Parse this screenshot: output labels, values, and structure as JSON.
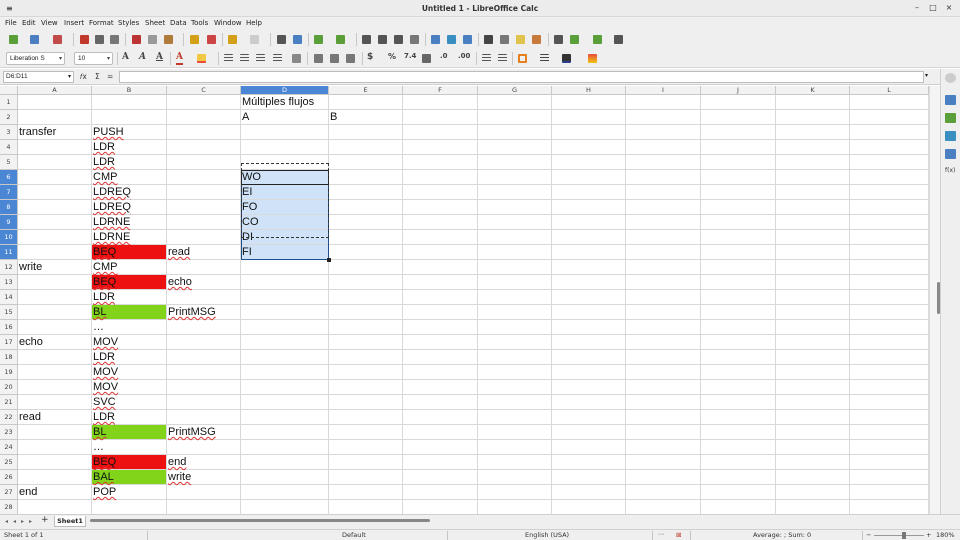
{
  "window": {
    "title": "Untitled 1 - LibreOffice Calc",
    "minimize": "–",
    "maximize": "□",
    "close": "×"
  },
  "menu": [
    "File",
    "Edit",
    "View",
    "Insert",
    "Format",
    "Styles",
    "Sheet",
    "Data",
    "Tools",
    "Window",
    "Help"
  ],
  "formatting": {
    "font_name": "Liberation S",
    "font_size": "10"
  },
  "formula_bar": {
    "name_box": "D6:D11",
    "value": ""
  },
  "columns": [
    "A",
    "B",
    "C",
    "D",
    "E",
    "F",
    "G",
    "H",
    "I",
    "J",
    "K",
    "L"
  ],
  "selected_column": "D",
  "selected_rows": [
    6,
    7,
    8,
    9,
    10,
    11
  ],
  "rows": [
    {
      "n": "1",
      "A": "",
      "B": "",
      "C": "",
      "D": "Múltiples flujos",
      "E": ""
    },
    {
      "n": "2",
      "A": "",
      "B": "",
      "C": "",
      "D": "A",
      "E": "B"
    },
    {
      "n": "3",
      "A": "transfer",
      "B": "PUSH",
      "C": "",
      "D": "",
      "E": ""
    },
    {
      "n": "4",
      "A": "",
      "B": "LDR",
      "C": "",
      "D": "",
      "E": ""
    },
    {
      "n": "5",
      "A": "",
      "B": "LDR",
      "C": "",
      "D": "",
      "E": ""
    },
    {
      "n": "6",
      "A": "",
      "B": "CMP",
      "C": "",
      "D": "WO",
      "E": ""
    },
    {
      "n": "7",
      "A": "",
      "B": "LDREQ",
      "C": "",
      "D": "EI",
      "E": ""
    },
    {
      "n": "8",
      "A": "",
      "B": "LDREQ",
      "C": "",
      "D": "FO",
      "E": ""
    },
    {
      "n": "9",
      "A": "",
      "B": "LDRNE",
      "C": "",
      "D": "CO",
      "E": ""
    },
    {
      "n": "10",
      "A": "",
      "B": "LDRNE",
      "C": "",
      "D": "DI",
      "E": ""
    },
    {
      "n": "11",
      "A": "",
      "B": "BEQ",
      "C": "read",
      "D": "FI",
      "E": ""
    },
    {
      "n": "12",
      "A": "write",
      "B": "CMP",
      "C": "",
      "D": "",
      "E": ""
    },
    {
      "n": "13",
      "A": "",
      "B": "BEQ",
      "C": "echo",
      "D": "",
      "E": ""
    },
    {
      "n": "14",
      "A": "",
      "B": "LDR",
      "C": "",
      "D": "",
      "E": ""
    },
    {
      "n": "15",
      "A": "",
      "B": "BL",
      "C": "PrintMSG",
      "D": "",
      "E": ""
    },
    {
      "n": "16",
      "A": "",
      "B": "…",
      "C": "",
      "D": "",
      "E": ""
    },
    {
      "n": "17",
      "A": "echo",
      "B": "MOV",
      "C": "",
      "D": "",
      "E": ""
    },
    {
      "n": "18",
      "A": "",
      "B": "LDR",
      "C": "",
      "D": "",
      "E": ""
    },
    {
      "n": "19",
      "A": "",
      "B": "MOV",
      "C": "",
      "D": "",
      "E": ""
    },
    {
      "n": "20",
      "A": "",
      "B": "MOV",
      "C": "",
      "D": "",
      "E": ""
    },
    {
      "n": "21",
      "A": "",
      "B": "SVC",
      "C": "",
      "D": "",
      "E": ""
    },
    {
      "n": "22",
      "A": "read",
      "B": "LDR",
      "C": "",
      "D": "",
      "E": ""
    },
    {
      "n": "23",
      "A": "",
      "B": "BL",
      "C": "PrintMSG",
      "D": "",
      "E": ""
    },
    {
      "n": "24",
      "A": "",
      "B": "…",
      "C": "",
      "D": "",
      "E": ""
    },
    {
      "n": "25",
      "A": "",
      "B": "BEQ",
      "C": "end",
      "D": "",
      "E": ""
    },
    {
      "n": "26",
      "A": "",
      "B": "BAL",
      "C": "write",
      "D": "",
      "E": ""
    },
    {
      "n": "27",
      "A": "end",
      "B": "POP",
      "C": "",
      "D": "",
      "E": ""
    },
    {
      "n": "28",
      "A": "",
      "B": "",
      "C": "",
      "D": "",
      "E": ""
    }
  ],
  "cell_fill": {
    "11": {
      "B": "red"
    },
    "13": {
      "B": "red"
    },
    "25": {
      "B": "red"
    },
    "15": {
      "B": "green"
    },
    "23": {
      "B": "green"
    },
    "26": {
      "B": "green"
    }
  },
  "colors": {
    "red_fill": "#ee1111",
    "green_fill": "#81d41a",
    "selection": "#cfe2f7",
    "header_selected": "#4a86d4"
  },
  "sheet_tabs": {
    "add": "+",
    "active": "Sheet1"
  },
  "status": {
    "sheet": "Sheet 1 of 1",
    "style": "Default",
    "language": "English (USA)",
    "summary": "Average: ; Sum: 0",
    "zoom": "180%"
  }
}
